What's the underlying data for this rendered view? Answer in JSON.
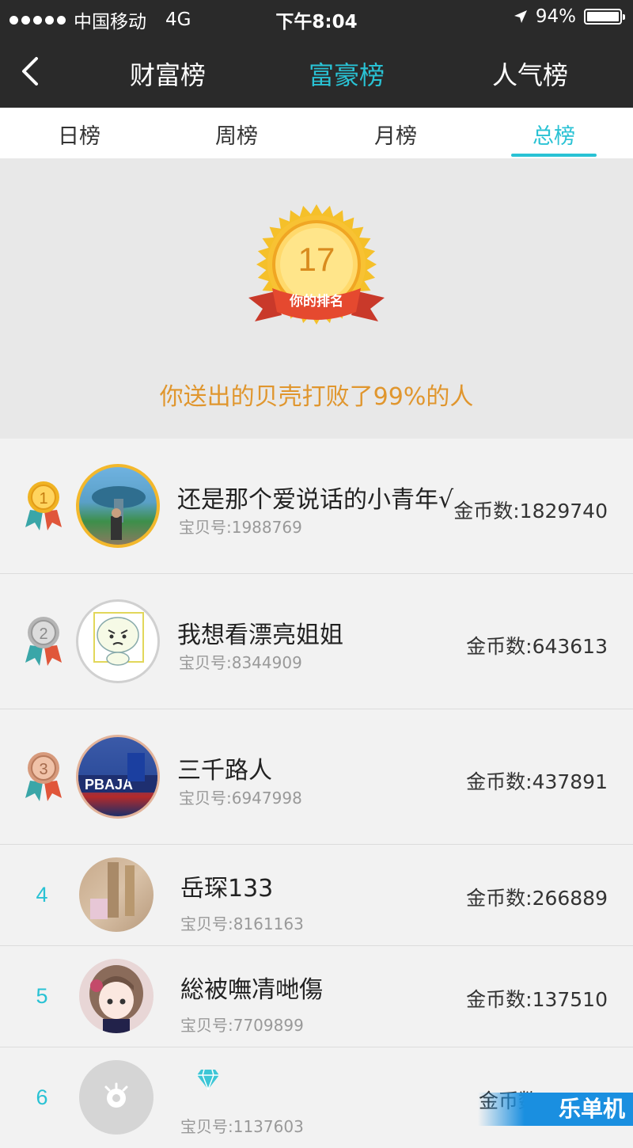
{
  "status_bar": {
    "carrier": "中国移动",
    "network": "4G",
    "time": "下午8:04",
    "battery": "94%"
  },
  "nav": {
    "tabs": [
      {
        "label": "财富榜",
        "active": false
      },
      {
        "label": "富豪榜",
        "active": true
      },
      {
        "label": "人气榜",
        "active": false
      }
    ]
  },
  "sub_tabs": [
    {
      "label": "日榜",
      "active": false
    },
    {
      "label": "周榜",
      "active": false
    },
    {
      "label": "月榜",
      "active": false
    },
    {
      "label": "总榜",
      "active": true
    }
  ],
  "my_rank": {
    "number": "17",
    "label": "你的排名",
    "summary": "你送出的贝壳打败了99%的人"
  },
  "leaderboard": [
    {
      "rank": "1",
      "name": "还是那个爱说话的小青年√",
      "uid": "宝贝号:1988769",
      "coins": "金币数:1829740",
      "medal": "gold"
    },
    {
      "rank": "2",
      "name": "我想看漂亮姐姐",
      "uid": "宝贝号:8344909",
      "coins": "金币数:643613",
      "medal": "silver"
    },
    {
      "rank": "3",
      "name": "三千路人",
      "uid": "宝贝号:6947998",
      "coins": "金币数:437891",
      "medal": "bronze"
    },
    {
      "rank": "4",
      "name": "岳琛133",
      "uid": "宝贝号:8161163",
      "coins": "金币数:266889"
    },
    {
      "rank": "5",
      "name": "総被嘸凊哋傷",
      "uid": "宝贝号:7709899",
      "coins": "金币数:137510"
    },
    {
      "rank": "6",
      "name": "",
      "uid": "宝贝号:1137603",
      "coins": "金币数:20000"
    }
  ],
  "watermark": "乐单机",
  "colors": {
    "accent": "#29c2d4",
    "header_bg": "#2a2a2a",
    "summary_text": "#e0962e",
    "medal_gold": "#f0b323",
    "medal_silver": "#b5b5b5",
    "medal_bronze": "#d79a7c"
  }
}
